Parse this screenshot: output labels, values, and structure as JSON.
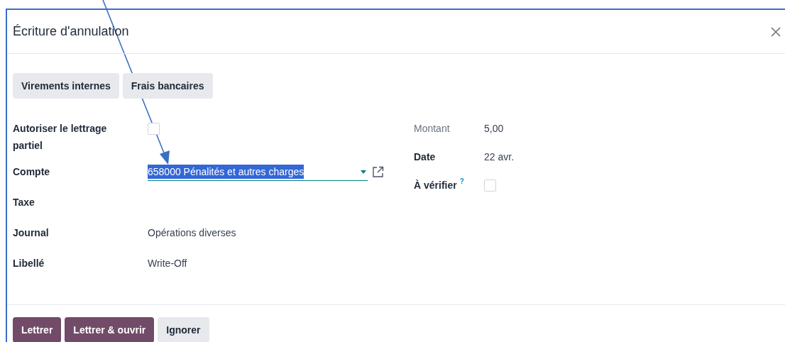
{
  "dialog": {
    "title": "Écriture d'annulation"
  },
  "quick_buttons": [
    {
      "label": "Virements internes"
    },
    {
      "label": "Frais bancaires"
    }
  ],
  "left_fields": [
    {
      "label": "Autoriser le lettrage partiel",
      "kind": "checkbox",
      "checked": false
    },
    {
      "label": "Compte",
      "kind": "select",
      "value": "658000 Pénalités et autres charges",
      "highlighted": true
    },
    {
      "label": "Taxe",
      "kind": "empty"
    },
    {
      "label": "Journal",
      "kind": "text",
      "value": "Opérations diverses"
    },
    {
      "label": "Libellé",
      "kind": "text",
      "value": "Write-Off"
    }
  ],
  "right_fields": [
    {
      "label": "Montant",
      "kind": "text",
      "value": "5,00",
      "disabled": true
    },
    {
      "label": "Date",
      "kind": "text",
      "value": "22 avr.",
      "disabled": false
    },
    {
      "label": "À vérifier",
      "kind": "checkbox",
      "checked": false,
      "help": "?",
      "disabled": false
    }
  ],
  "footer_buttons": [
    {
      "label": "Lettrer",
      "primary": true
    },
    {
      "label": "Lettrer & ouvrir",
      "primary": true
    },
    {
      "label": "Ignorer",
      "primary": false
    }
  ]
}
